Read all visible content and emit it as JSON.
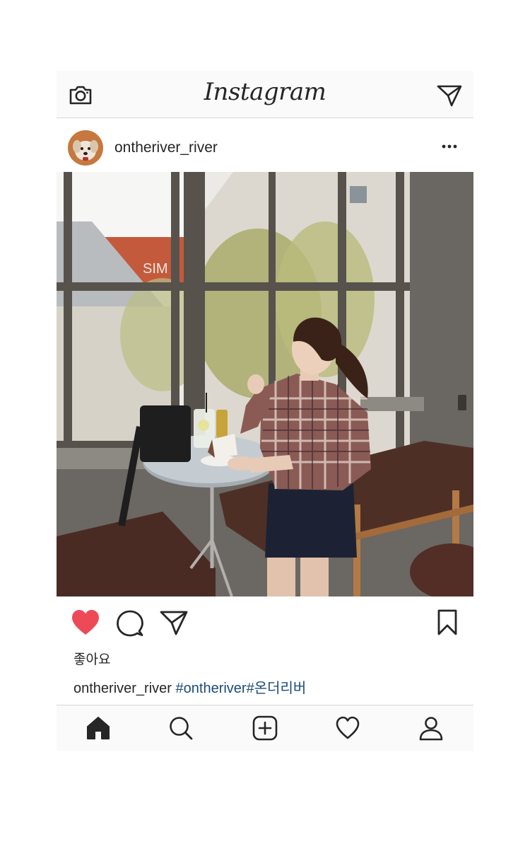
{
  "app": {
    "title": "Instagram"
  },
  "topbar": {
    "left_icon": "camera-icon",
    "right_icon": "direct-message-icon"
  },
  "post": {
    "username": "ontheriver_river",
    "avatar_icon": "avatar",
    "more_icon": "more-options-icon",
    "photo_signage_text": "SIM",
    "liked": true,
    "likes_text": "좋아요",
    "caption_username": "ontheriver_river",
    "caption_hashtags": "#ontheriver#온더리버"
  },
  "actions": {
    "icons": [
      "heart-filled-icon",
      "comment-icon",
      "share-icon",
      "bookmark-icon"
    ]
  },
  "bottom_nav": {
    "icons": [
      "home-icon",
      "search-icon",
      "add-post-icon",
      "activity-heart-icon",
      "profile-icon"
    ]
  },
  "colors": {
    "like_red": "#ed4956",
    "hashtag_blue": "#1c4c7a",
    "bar_bg": "#fafafa",
    "divider": "#d6d6d6",
    "text": "#262626"
  }
}
